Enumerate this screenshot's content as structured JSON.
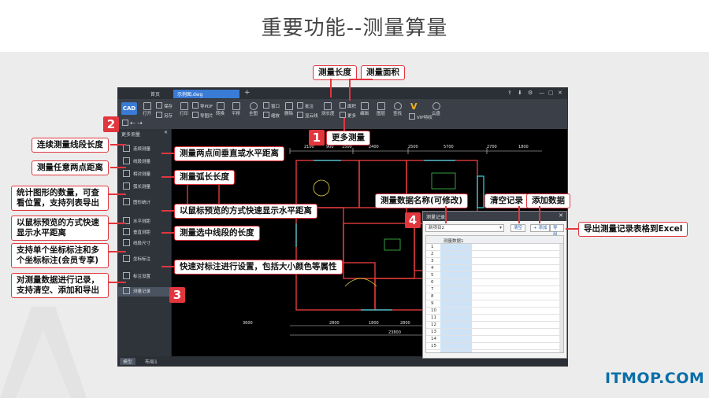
{
  "title": "重要功能--测量算量",
  "watermark": "ITMOP.COM",
  "app": {
    "tabs": {
      "home": "首页",
      "file": "示例图.dwg",
      "plus": "+"
    },
    "window_controls": [
      "⇪",
      "⬇",
      "⚙",
      "—",
      "▢",
      "✕"
    ],
    "logo": "CAD",
    "toolbar": {
      "open": "打开",
      "save": "保存",
      "save_as": "另存",
      "print": "打印",
      "export_pdf": "导PDF",
      "export_image": "导图片",
      "convert": "转换",
      "pan": "平移",
      "fit": "全图",
      "window": "窗口",
      "zoom": "缩放",
      "delete": "删除",
      "annotate": "批注",
      "show_cloud": "显云线",
      "measure_length": "测长度",
      "measure_area": "面积",
      "more": "更多",
      "edit": "编辑",
      "layers": "图层",
      "find": "查找",
      "vip": "VIP特权",
      "cloud": "云盘"
    },
    "side_panel": {
      "title": "更多测量",
      "close": "✕",
      "items": [
        "连续测量",
        "线段测量",
        "相对测量",
        "弧长测量",
        "图形统计",
        "水平测距",
        "垂直测距",
        "线段尺寸",
        "坐标标注",
        "标注设置",
        "测量记录"
      ]
    },
    "status": {
      "model": "模型",
      "layout": "布局1"
    }
  },
  "dialog": {
    "title": "测量记录",
    "close": "✕",
    "select_value": "新项目2",
    "buttons": {
      "clear": "清空",
      "add": "+ 添加",
      "export": "导出"
    },
    "column_header": "测量数据1",
    "rows": [
      "1",
      "2",
      "3",
      "4",
      "5",
      "6",
      "7",
      "8",
      "9",
      "10",
      "11",
      "12",
      "13",
      "14",
      "15"
    ]
  },
  "callouts": {
    "measure_length": "测量长度",
    "measure_area": "测量面积",
    "more_measure": "更多测量",
    "continuous": "连续测量线段长度",
    "two_points": "测量两点间垂直或水平距离",
    "any_two_points": "测量任意两点距离",
    "arc_length": "测量弧长长度",
    "shape_stat": "统计图形的数量，可查看位置，支持列表导出",
    "mouse_preview": "以鼠标预览的方式快速显示水平距离",
    "mouse_preview_h": "以鼠标预览的方式快速显示水平距离",
    "segment": "测量选中线段的长度",
    "coord": "支持单个坐标标注和多个坐标标注(会员专享)",
    "settings": "快速对标注进行设置，包括大小颜色等属性",
    "record": "对测量数据进行记录，支持清空、添加和导出",
    "data_name": "测量数据名称(可修改)",
    "clear_record": "清空记录",
    "add_data": "添加数据",
    "export_excel": "导出测量记录表格到Excel"
  },
  "badges": [
    "1",
    "2",
    "3",
    "4"
  ],
  "drawing_dims": {
    "top": [
      "2100",
      "900",
      "1500",
      "2400",
      "2500",
      "5700",
      "2700",
      "1800"
    ],
    "bottom": [
      "3600",
      "2800",
      "1800",
      "2800"
    ],
    "total": "23800"
  },
  "colors": {
    "accent": "#e2363e",
    "app_bg": "#000000",
    "toolbar": "#3b4048",
    "watermark": "#0a6ea8"
  }
}
